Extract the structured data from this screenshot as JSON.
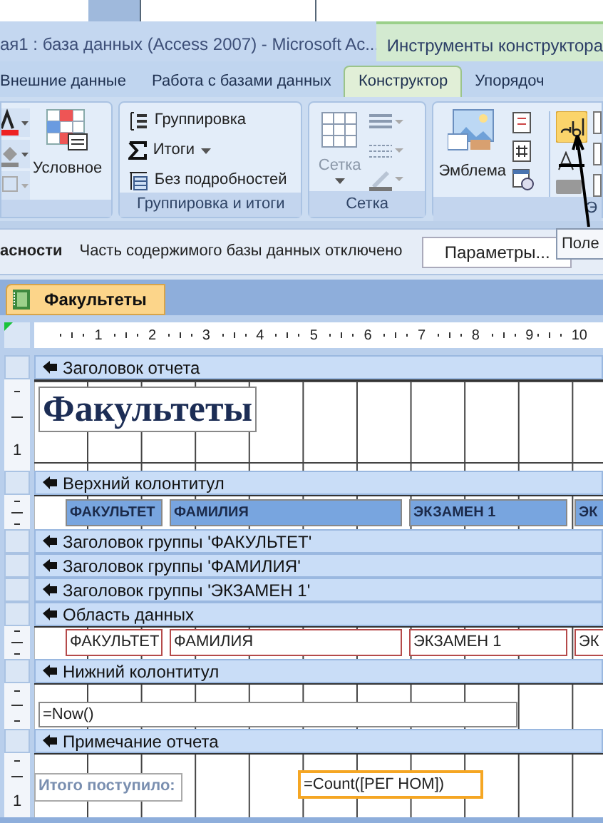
{
  "window": {
    "title": "ая1 : база данных (Access 2007)  - Microsoft Ac...",
    "context_tab": "Инструменты конструктора"
  },
  "ribbon_tabs": [
    {
      "label": "Внешние данные",
      "selected": false
    },
    {
      "label": "Работа с базами данных",
      "selected": false
    },
    {
      "label": "Конструктор",
      "selected": true
    },
    {
      "label": "Упорядоч",
      "selected": false
    }
  ],
  "ribbon": {
    "format_group": {
      "button": "Условное"
    },
    "grouping_group": {
      "items": [
        {
          "label": "Группировка",
          "kind": "grouping"
        },
        {
          "label": "Итоги",
          "kind": "totals"
        },
        {
          "label": "Без подробностей",
          "kind": "details"
        }
      ],
      "label": "Группировка и итоги"
    },
    "gridlines_group": {
      "button": "Сетка",
      "label": "Сетка"
    },
    "controls_group": {
      "button": "Эмблема",
      "label": "Э"
    }
  },
  "message_bar": {
    "title": "асности",
    "text": "Часть содержимого базы данных отключено",
    "button": "Параметры..."
  },
  "tooltip": "Поле",
  "document_tab": {
    "label": "Факультеты",
    "selected": true
  },
  "ruler": [
    "1",
    "2",
    "3",
    "4",
    "5",
    "6",
    "7",
    "8",
    "9",
    "10"
  ],
  "report_sections": [
    {
      "title": "Заголовок отчета",
      "kind": "title",
      "ruler_mark": "1",
      "controls": [
        {
          "text": "Факультеты"
        }
      ]
    },
    {
      "title": "Верхний колонтитул",
      "kind": "labels",
      "controls": [
        {
          "text": "ФАКУЛЬТЕТ"
        },
        {
          "text": "ФАМИЛИЯ"
        },
        {
          "text": "ЭКЗАМЕН 1"
        },
        {
          "text": "ЭК"
        }
      ]
    },
    {
      "title": "Заголовок группы 'ФАКУЛЬТЕТ'",
      "kind": "empty"
    },
    {
      "title": "Заголовок группы 'ФАМИЛИЯ'",
      "kind": "empty"
    },
    {
      "title": "Заголовок группы 'ЭКЗАМЕН 1'",
      "kind": "empty"
    },
    {
      "title": "Область данных",
      "kind": "fields",
      "controls": [
        {
          "text": "ФАКУЛЬТЕТ"
        },
        {
          "text": "ФАМИЛИЯ"
        },
        {
          "text": "ЭКЗАМЕН 1"
        },
        {
          "text": "ЭК"
        }
      ]
    },
    {
      "title": "Нижний колонтитул",
      "kind": "footer",
      "controls": [
        {
          "text": "=Now()"
        }
      ]
    },
    {
      "title": "Примечание отчета",
      "kind": "summary",
      "ruler_mark": "1",
      "controls": [
        {
          "text": "Итого поступило:",
          "selected": false
        },
        {
          "text": "=Count([РЕГ НОМ])",
          "selected": true
        }
      ]
    }
  ]
}
